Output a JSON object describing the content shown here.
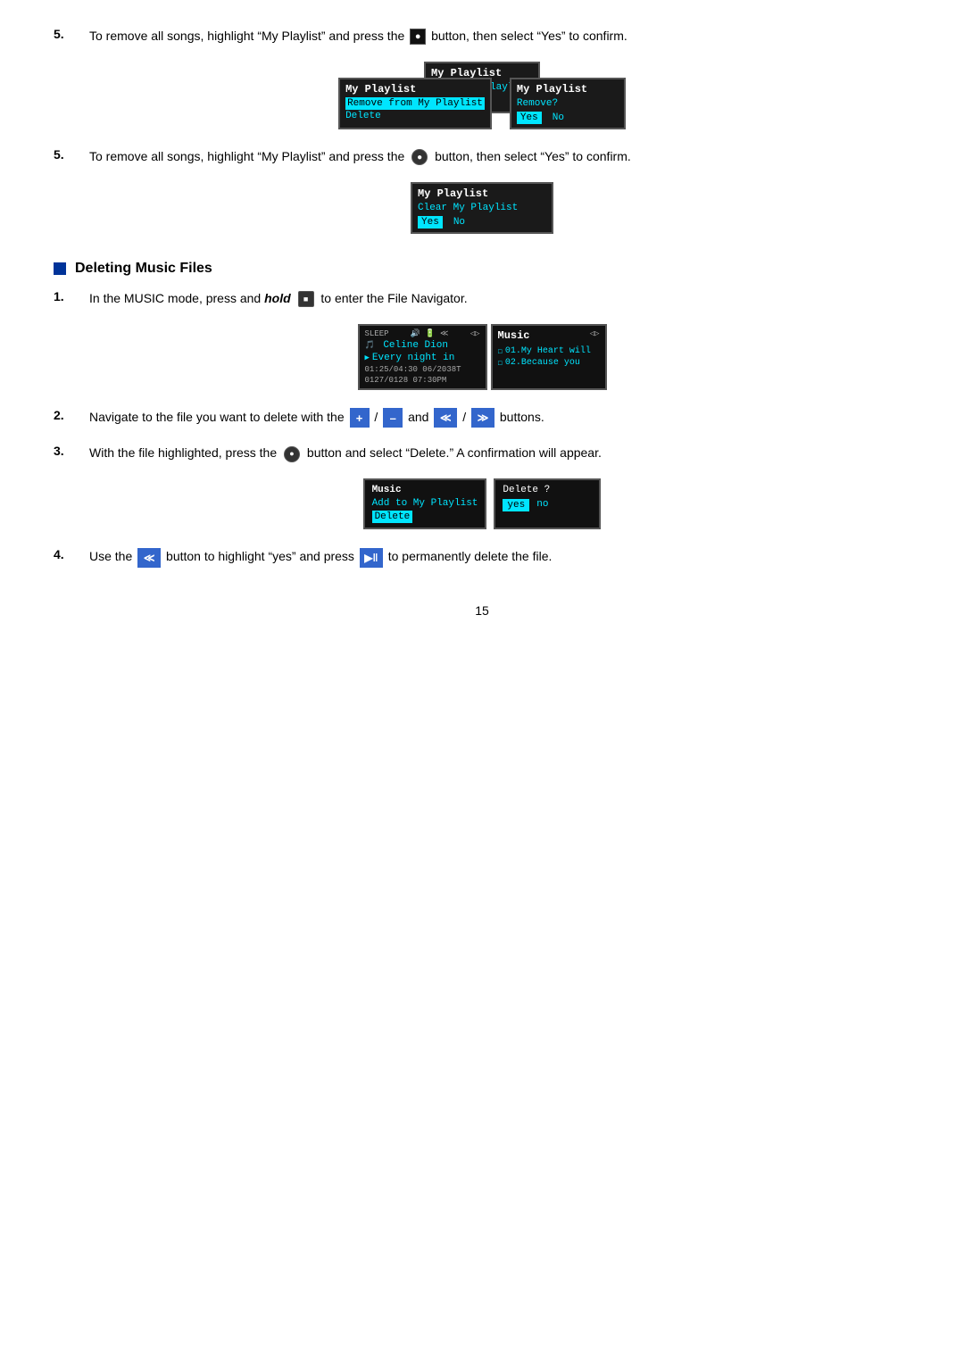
{
  "step5": {
    "text_before": "To remove all songs, highlight “My Playlist” and press the",
    "text_after": "button, then select “Yes” to confirm."
  },
  "section_heading": "Deleting Music Files",
  "step1": {
    "number": "1.",
    "text_before": "In the MUSIC mode, press and",
    "italic": "hold",
    "text_after": "to enter the File Navigator."
  },
  "step2": {
    "number": "2.",
    "text": "Navigate to the file you want to delete with the",
    "and_text": "and",
    "buttons_text": "buttons."
  },
  "step3": {
    "number": "3.",
    "text_before": "With the file highlighted, press the",
    "text_after": "button and select “Delete.” A confirmation will appear."
  },
  "step4": {
    "number": "4.",
    "text_before": "Use the",
    "text_middle": "button to highlight “yes” and press",
    "text_after": "to permanently delete the file."
  },
  "screens": {
    "playlist_left_title": "My Playlist",
    "playlist_left_item1": "Remove from My Playlist",
    "playlist_left_item2": "Delete",
    "playlist_right_title": "My Playlist",
    "playlist_right_text": "Remove?",
    "playlist_right_yes": "Yes",
    "playlist_right_no": "No",
    "clear_playlist_title": "My Playlist",
    "clear_playlist_item": "Clear My Playlist",
    "clear_playlist_yes": "Yes",
    "clear_playlist_no": "No",
    "music_left_sleep": "SLEEP",
    "music_left_artist": "Celine  Dion",
    "music_left_song": "Every night in",
    "music_left_time1": "01:25/04:30  06/2038T",
    "music_left_time2": "0127/0128  07:30PM",
    "music_right_title": "Music",
    "music_right_file1": "01.My Heart will",
    "music_right_file2": "02.Because you",
    "delete_left_title": "Music",
    "delete_left_item1": "Add to My Playlist",
    "delete_left_item2": "Delete",
    "delete_right_text": "Delete ?",
    "delete_right_yes": "yes",
    "delete_right_no": "no"
  },
  "page_number": "15"
}
